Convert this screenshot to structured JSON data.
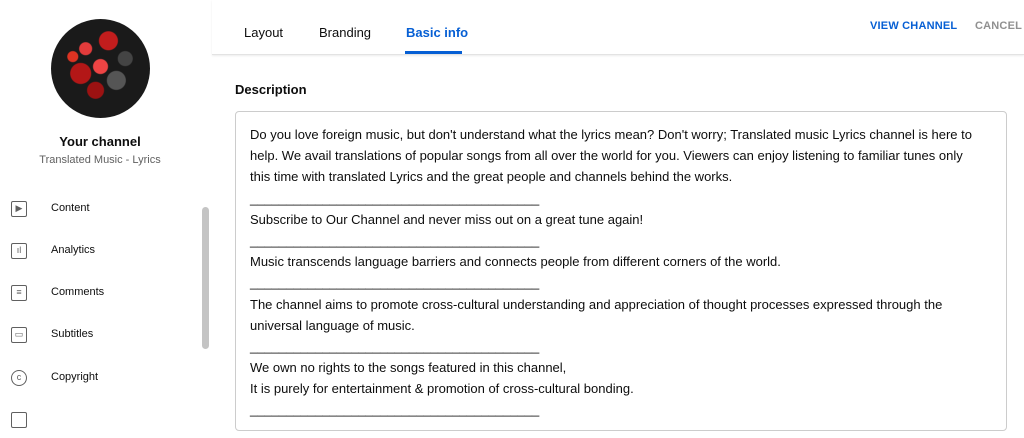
{
  "sidebar": {
    "channel_title": "Your channel",
    "channel_name": "Translated Music - Lyrics",
    "items": [
      {
        "label": "Content",
        "icon": "content-icon",
        "glyph": "▶"
      },
      {
        "label": "Analytics",
        "icon": "analytics-icon",
        "glyph": "ıl"
      },
      {
        "label": "Comments",
        "icon": "comments-icon",
        "glyph": "≡"
      },
      {
        "label": "Subtitles",
        "icon": "subtitles-icon",
        "glyph": "▭"
      },
      {
        "label": "Copyright",
        "icon": "copyright-icon",
        "glyph": "c"
      }
    ]
  },
  "header": {
    "tabs": [
      {
        "label": "Layout",
        "active": false
      },
      {
        "label": "Branding",
        "active": false
      },
      {
        "label": "Basic info",
        "active": true
      }
    ],
    "view_channel": "VIEW CHANNEL",
    "cancel": "CANCEL"
  },
  "description": {
    "heading": "Description",
    "lines": [
      "Do you love foreign music, but don't understand what the lyrics mean? Don't worry; Translated music Lyrics channel is here to",
      "help. We avail translations of popular songs from all over the world for you.  Viewers can enjoy listening to familiar tunes only",
      "this time with translated Lyrics and the great people and channels behind the works.",
      "________________________________________",
      "Subscribe to Our Channel and never miss out on a great tune again!",
      "________________________________________",
      "Music transcends language barriers and connects people from different corners of the world.",
      "________________________________________",
      "The channel aims to promote cross-cultural understanding and appreciation of thought processes expressed through the",
      "universal language of music.",
      "________________________________________",
      "We own no rights to the songs featured in this channel,",
      "It is purely for entertainment & promotion of cross-cultural bonding.",
      "________________________________________"
    ]
  },
  "colors": {
    "accent": "#065fd4",
    "muted": "#606060",
    "border": "#cccccc"
  }
}
